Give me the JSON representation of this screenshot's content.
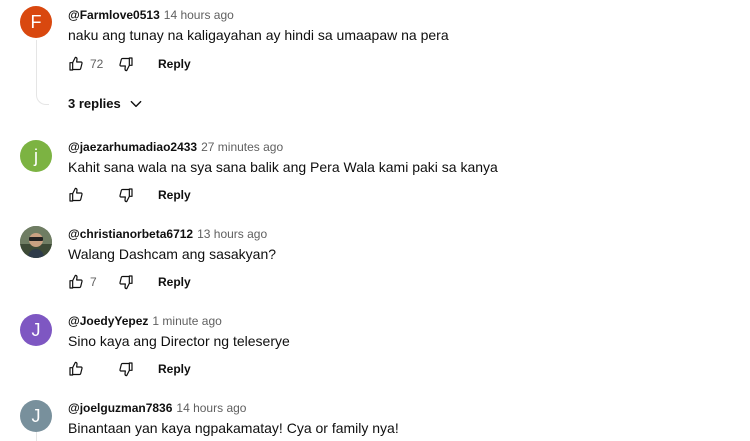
{
  "comments": [
    {
      "author": "@Farmlove0513",
      "time": "14 hours ago",
      "text": "naku ang tunay na kaligayahan ay hindi sa umaapaw na pera",
      "likes": "72",
      "reply_label": "Reply",
      "avatar_letter": "F",
      "avatar_color": "#d9480f",
      "replies_label": "3 replies"
    },
    {
      "author": "@jaezarhumadiao2433",
      "time": "27 minutes ago",
      "text": "Kahit sana wala na sya sana balik ang Pera Wala kami paki sa kanya",
      "likes": "",
      "reply_label": "Reply",
      "avatar_letter": "j",
      "avatar_color": "#7cb342"
    },
    {
      "author": "@christianorbeta6712",
      "time": "13 hours ago",
      "text": "Walang Dashcam ang sasakyan?",
      "likes": "7",
      "reply_label": "Reply",
      "avatar_letter": "",
      "avatar_color": "#5b6b5a"
    },
    {
      "author": "@JoedyYepez",
      "time": "1 minute ago",
      "text": "Sino kaya ang Director ng teleserye",
      "likes": "",
      "reply_label": "Reply",
      "avatar_letter": "J",
      "avatar_color": "#7e57c2"
    },
    {
      "author": "@joelguzman7836",
      "time": "14 hours ago",
      "text": "Binantaan yan kaya ngpakamatay! Cya or family nya!",
      "avatar_letter": "J",
      "avatar_color": "#78909c"
    }
  ]
}
